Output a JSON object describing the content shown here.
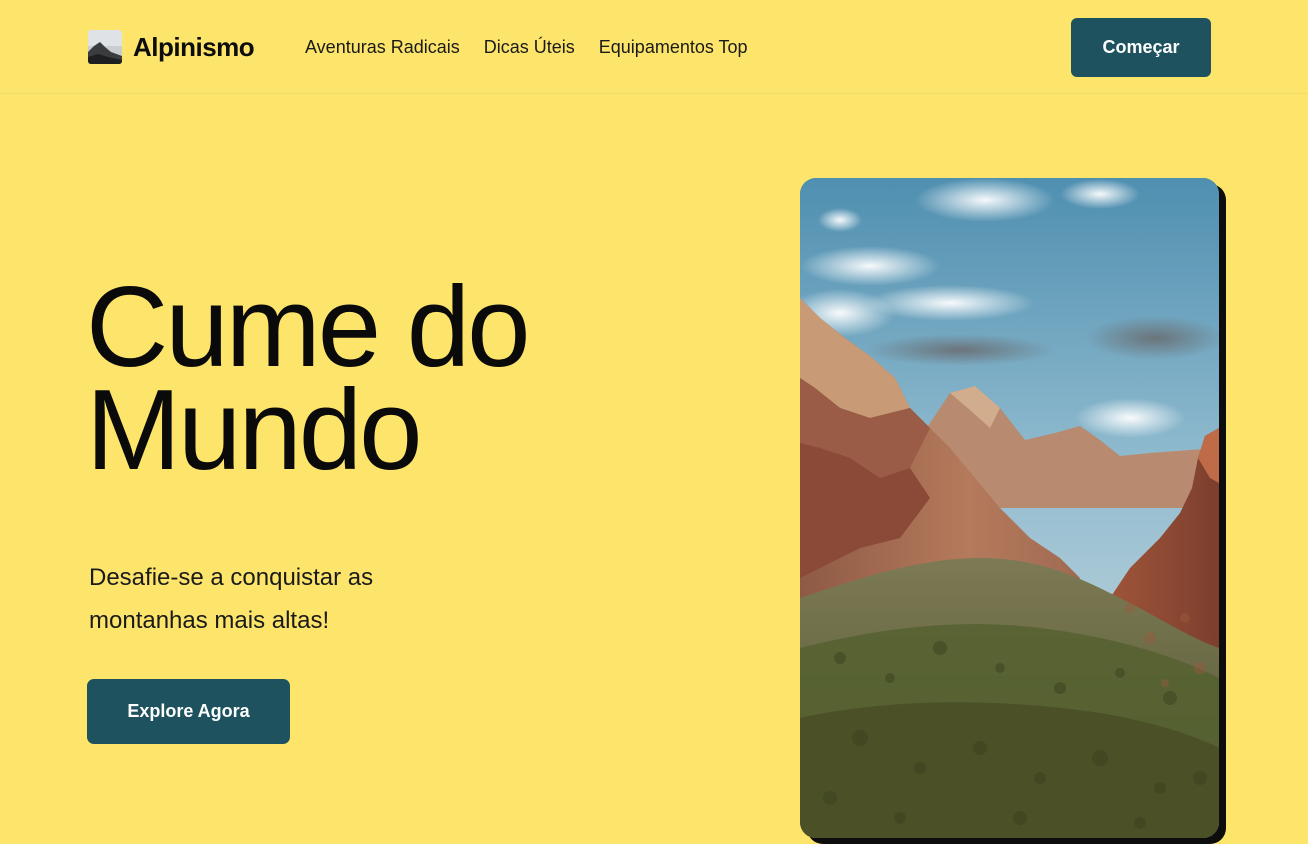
{
  "header": {
    "logo_text": "Alpinismo",
    "logo_icon": "mountain-photo-icon",
    "nav": [
      {
        "label": "Aventuras Radicais"
      },
      {
        "label": "Dicas Úteis"
      },
      {
        "label": "Equipamentos Top"
      }
    ],
    "cta_label": "Começar"
  },
  "hero": {
    "title_line1": "Cume do",
    "title_line2": "Mundo",
    "subtitle_line1": "Desafie-se a conquistar as",
    "subtitle_line2": "montanhas mais altas!",
    "cta_label": "Explore Agora"
  },
  "colors": {
    "background": "#fde56c",
    "button": "#1d525e",
    "button_text": "#ffffff",
    "text": "#0a0a0a"
  }
}
